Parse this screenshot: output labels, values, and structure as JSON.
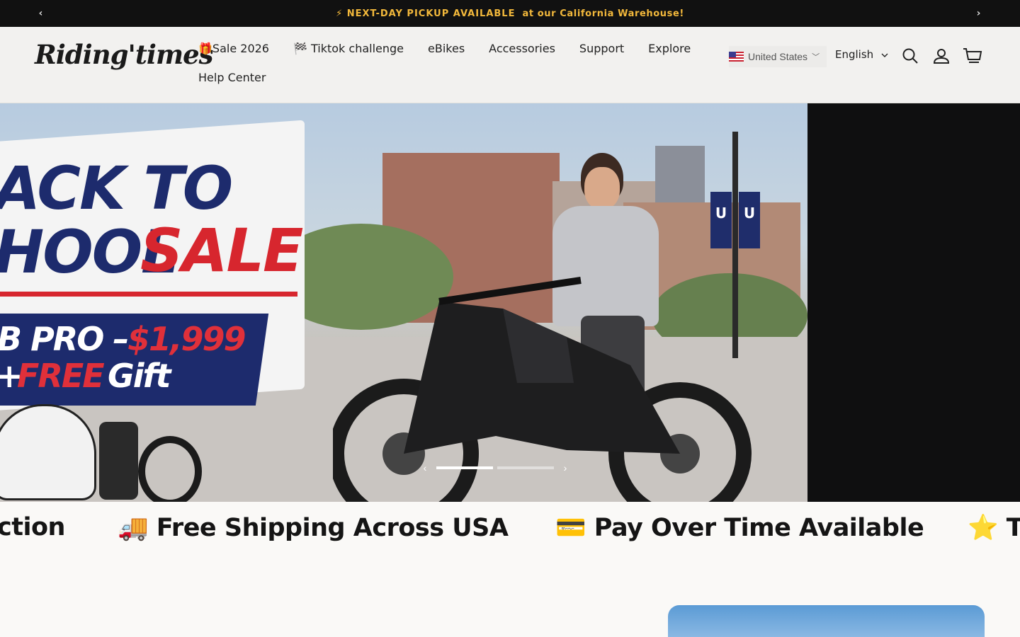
{
  "announcement": {
    "icon": "lightning-icon",
    "highlight": "⚡ NEXT-DAY PICKUP AVAILABLE",
    "rest": "at our California Warehouse!",
    "prev_arrow": "‹",
    "next_arrow": "›"
  },
  "header": {
    "logo": "Riding'times",
    "nav": [
      {
        "label": "🎁Sale 2026"
      },
      {
        "label": "🏁 Tiktok challenge"
      },
      {
        "label": "eBikes"
      },
      {
        "label": "Accessories"
      },
      {
        "label": "Support"
      },
      {
        "label": "Explore"
      },
      {
        "label": "Help Center"
      }
    ],
    "country": "United States",
    "language": "English",
    "icons": [
      "search-icon",
      "account-icon",
      "cart-icon"
    ]
  },
  "hero": {
    "line1": "ACK TO",
    "line2_a": "HOOL",
    "line2_b": "SALE",
    "price_a": "B PRO –",
    "price_b": "$1,999",
    "gift_a": "+",
    "gift_b": "FREE",
    "gift_c": "Gift",
    "banner_text": "U",
    "active_slide": 1,
    "slide_count": 2,
    "colors": {
      "navy": "#1d2b6d",
      "red": "#d7262e",
      "dark": "#0f0f10"
    }
  },
  "ticker": [
    {
      "text": "ction"
    },
    {
      "text": "🚚 Free Shipping Across USA"
    },
    {
      "text": "💳 Pay Over Time Available"
    },
    {
      "text": "⭐ T"
    }
  ]
}
